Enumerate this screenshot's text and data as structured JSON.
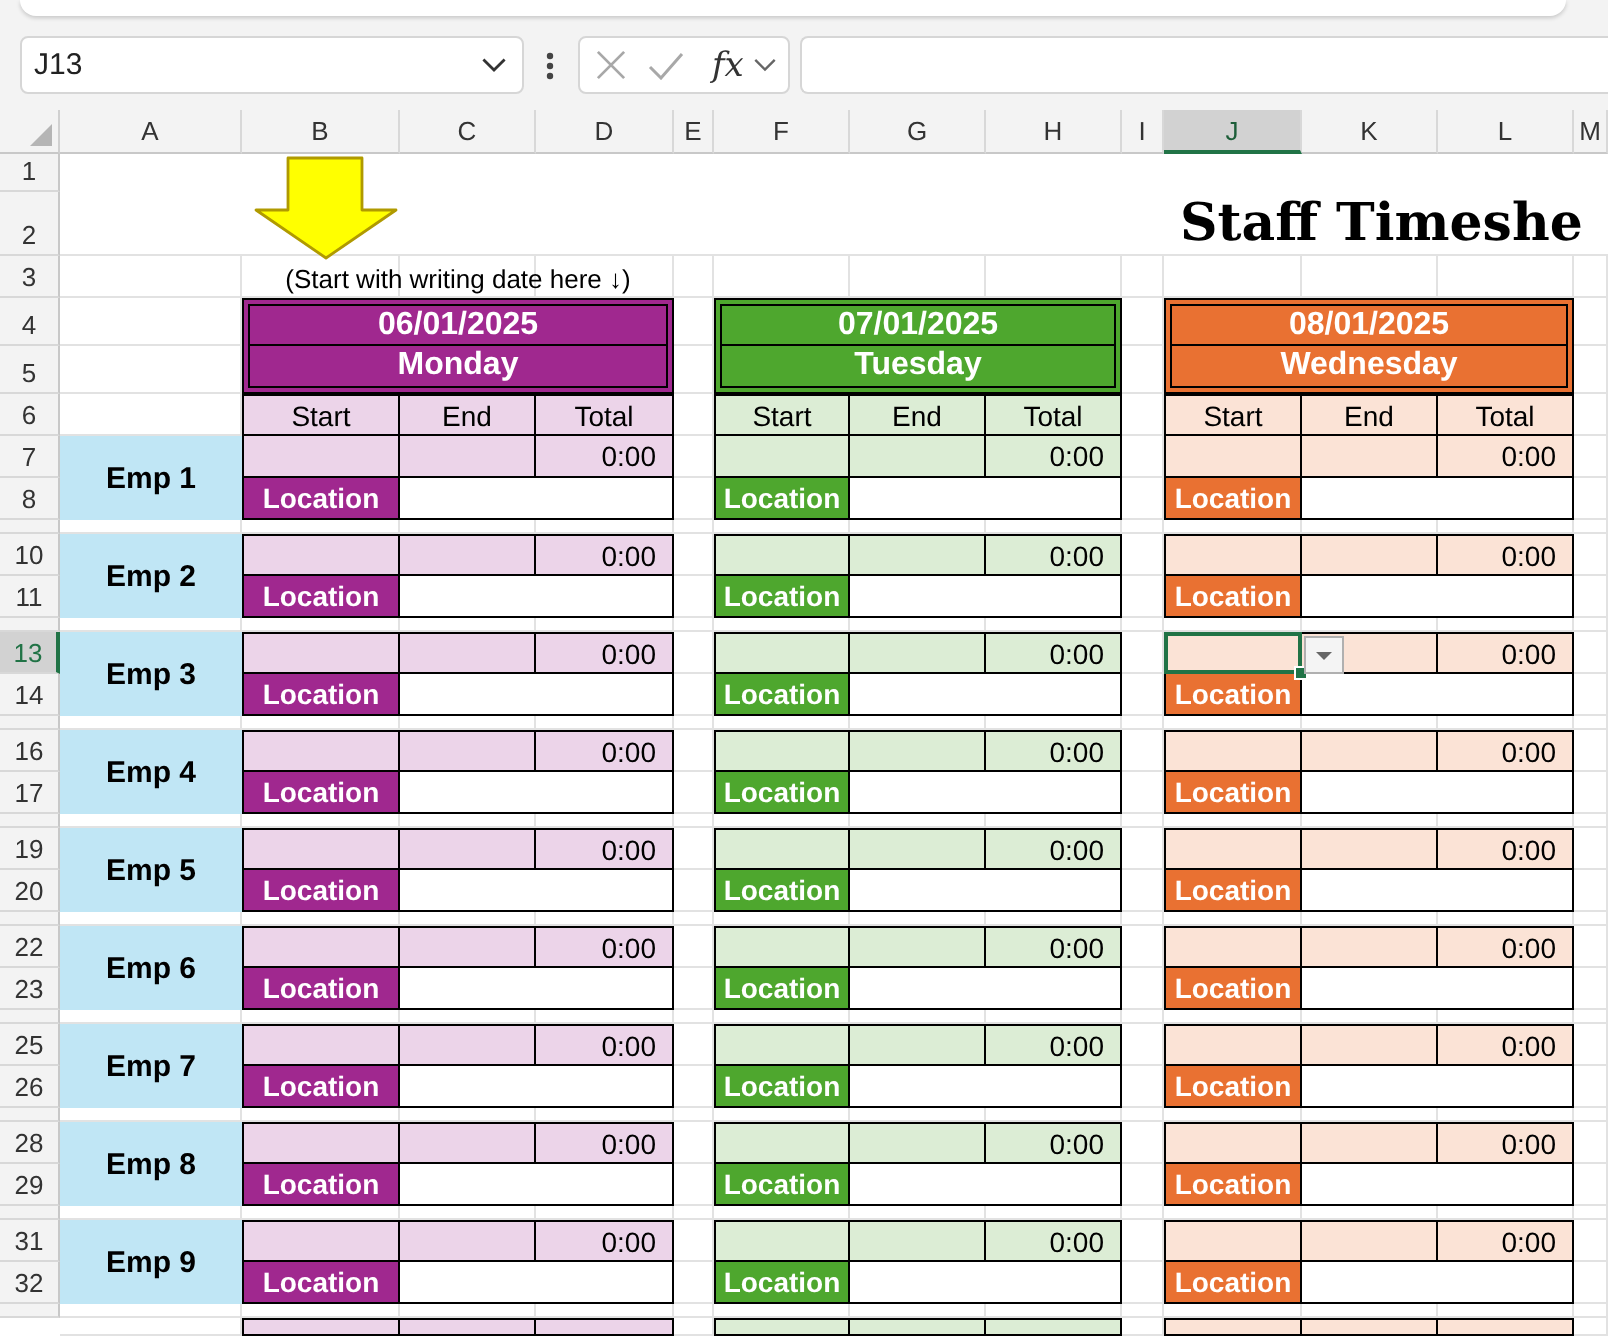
{
  "name_box": {
    "value": "J13"
  },
  "formula_bar": {
    "function_label": "fx"
  },
  "column_headers": [
    {
      "label": "A",
      "selected": false
    },
    {
      "label": "B",
      "selected": false
    },
    {
      "label": "C",
      "selected": false
    },
    {
      "label": "D",
      "selected": false
    },
    {
      "label": "E",
      "selected": false
    },
    {
      "label": "F",
      "selected": false
    },
    {
      "label": "G",
      "selected": false
    },
    {
      "label": "H",
      "selected": false
    },
    {
      "label": "I",
      "selected": false
    },
    {
      "label": "J",
      "selected": true
    },
    {
      "label": "K",
      "selected": false
    },
    {
      "label": "L",
      "selected": false
    },
    {
      "label": "M",
      "selected": false
    }
  ],
  "row_headers": [
    {
      "label": "1",
      "selected": false
    },
    {
      "label": "2",
      "selected": false
    },
    {
      "label": "3",
      "selected": false
    },
    {
      "label": "4",
      "selected": false
    },
    {
      "label": "5",
      "selected": false
    },
    {
      "label": "6",
      "selected": false
    }
  ],
  "title": "Staff Timeshe",
  "hint": "(Start with writing date here ↓)",
  "days": [
    {
      "date": "06/01/2025",
      "day": "Monday",
      "color": "#a0288f",
      "headings": [
        "Start",
        "End",
        "Total"
      ]
    },
    {
      "date": "07/01/2025",
      "day": "Tuesday",
      "color": "#4ea72e",
      "headings": [
        "Start",
        "End",
        "Total"
      ]
    },
    {
      "date": "08/01/2025",
      "day": "Wednesday",
      "color": "#e97132",
      "headings": [
        "Start",
        "End",
        "Total"
      ]
    }
  ],
  "employees": [
    {
      "name": "Emp 1",
      "rows": [
        {
          "label": "7",
          "selected": false
        },
        {
          "label": "8",
          "selected": false
        }
      ],
      "shifts": [
        {
          "total": "0:00",
          "location_label": "Location",
          "start_selected": false
        },
        {
          "total": "0:00",
          "location_label": "Location",
          "start_selected": false
        },
        {
          "total": "0:00",
          "location_label": "Location",
          "start_selected": false
        }
      ]
    },
    {
      "name": "Emp 2",
      "rows": [
        {
          "label": "10",
          "selected": false
        },
        {
          "label": "11",
          "selected": false
        }
      ],
      "shifts": [
        {
          "total": "0:00",
          "location_label": "Location",
          "start_selected": false
        },
        {
          "total": "0:00",
          "location_label": "Location",
          "start_selected": false
        },
        {
          "total": "0:00",
          "location_label": "Location",
          "start_selected": false
        }
      ]
    },
    {
      "name": "Emp 3",
      "rows": [
        {
          "label": "13",
          "selected": true
        },
        {
          "label": "14",
          "selected": false
        }
      ],
      "shifts": [
        {
          "total": "0:00",
          "location_label": "Location",
          "start_selected": false
        },
        {
          "total": "0:00",
          "location_label": "Location",
          "start_selected": false
        },
        {
          "total": "0:00",
          "location_label": "Location",
          "start_selected": true
        }
      ]
    },
    {
      "name": "Emp 4",
      "rows": [
        {
          "label": "16",
          "selected": false
        },
        {
          "label": "17",
          "selected": false
        }
      ],
      "shifts": [
        {
          "total": "0:00",
          "location_label": "Location",
          "start_selected": false
        },
        {
          "total": "0:00",
          "location_label": "Location",
          "start_selected": false
        },
        {
          "total": "0:00",
          "location_label": "Location",
          "start_selected": false
        }
      ]
    },
    {
      "name": "Emp 5",
      "rows": [
        {
          "label": "19",
          "selected": false
        },
        {
          "label": "20",
          "selected": false
        }
      ],
      "shifts": [
        {
          "total": "0:00",
          "location_label": "Location",
          "start_selected": false
        },
        {
          "total": "0:00",
          "location_label": "Location",
          "start_selected": false
        },
        {
          "total": "0:00",
          "location_label": "Location",
          "start_selected": false
        }
      ]
    },
    {
      "name": "Emp 6",
      "rows": [
        {
          "label": "22",
          "selected": false
        },
        {
          "label": "23",
          "selected": false
        }
      ],
      "shifts": [
        {
          "total": "0:00",
          "location_label": "Location",
          "start_selected": false
        },
        {
          "total": "0:00",
          "location_label": "Location",
          "start_selected": false
        },
        {
          "total": "0:00",
          "location_label": "Location",
          "start_selected": false
        }
      ]
    },
    {
      "name": "Emp 7",
      "rows": [
        {
          "label": "25",
          "selected": false
        },
        {
          "label": "26",
          "selected": false
        }
      ],
      "shifts": [
        {
          "total": "0:00",
          "location_label": "Location",
          "start_selected": false
        },
        {
          "total": "0:00",
          "location_label": "Location",
          "start_selected": false
        },
        {
          "total": "0:00",
          "location_label": "Location",
          "start_selected": false
        }
      ]
    },
    {
      "name": "Emp 8",
      "rows": [
        {
          "label": "28",
          "selected": false
        },
        {
          "label": "29",
          "selected": false
        }
      ],
      "shifts": [
        {
          "total": "0:00",
          "location_label": "Location",
          "start_selected": false
        },
        {
          "total": "0:00",
          "location_label": "Location",
          "start_selected": false
        },
        {
          "total": "0:00",
          "location_label": "Location",
          "start_selected": false
        }
      ]
    },
    {
      "name": "Emp 9",
      "rows": [
        {
          "label": "31",
          "selected": false
        },
        {
          "label": "32",
          "selected": false
        }
      ],
      "shifts": [
        {
          "total": "0:00",
          "location_label": "Location",
          "start_selected": false
        },
        {
          "total": "0:00",
          "location_label": "Location",
          "start_selected": false
        },
        {
          "total": "0:00",
          "location_label": "Location",
          "start_selected": false
        }
      ]
    }
  ],
  "next_row_cut_off": true
}
